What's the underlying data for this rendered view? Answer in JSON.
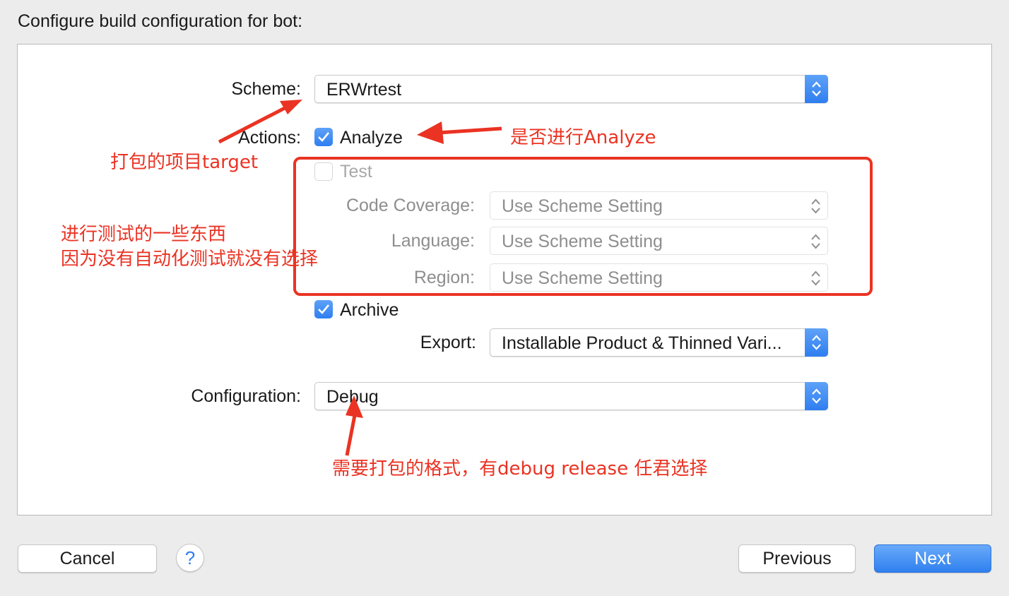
{
  "dialog": {
    "title": "Configure build configuration for bot:"
  },
  "form": {
    "scheme": {
      "label": "Scheme:",
      "value": "ERWrtest"
    },
    "actions": {
      "label": "Actions:"
    },
    "analyze": {
      "label": "Analyze",
      "checked": true
    },
    "test": {
      "label": "Test",
      "checked": false,
      "enabled": false
    },
    "code_coverage": {
      "label": "Code Coverage:",
      "value": "Use Scheme Setting"
    },
    "language": {
      "label": "Language:",
      "value": "Use Scheme Setting"
    },
    "region": {
      "label": "Region:",
      "value": "Use Scheme Setting"
    },
    "archive": {
      "label": "Archive",
      "checked": true
    },
    "export": {
      "label": "Export:",
      "value": "Installable Product & Thinned Vari..."
    },
    "configuration": {
      "label": "Configuration:",
      "value": "Debug"
    }
  },
  "annotations": {
    "scheme_note": "打包的项目target",
    "analyze_note": "是否进行Analyze",
    "test_note_line1": "进行测试的一些东西",
    "test_note_line2": "因为没有自动化测试就没有选择",
    "config_note": "需要打包的格式，有debug release 任君选择",
    "color": "#ea3323"
  },
  "footer": {
    "cancel_label": "Cancel",
    "help_label": "?",
    "previous_label": "Previous",
    "next_label": "Next"
  },
  "colors": {
    "accent": "#2f7ef0",
    "window_bg": "#ececec"
  }
}
